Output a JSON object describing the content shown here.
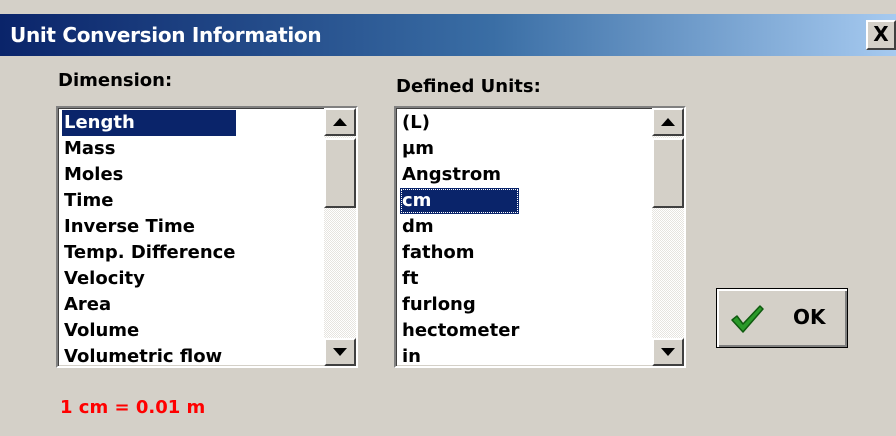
{
  "window": {
    "title": "Unit Conversion Information",
    "close_label": "X"
  },
  "dimension": {
    "label": "Dimension:",
    "selected": "Length",
    "items": [
      "Length",
      "Mass",
      "Moles",
      "Time",
      "Inverse Time",
      "Temp. Difference",
      "Velocity",
      "Area",
      "Volume",
      "Volumetric flow"
    ]
  },
  "units": {
    "label": "Defined Units:",
    "selected": "cm",
    "items": [
      "(L)",
      "µm",
      "Angstrom",
      "cm",
      "dm",
      "fathom",
      "ft",
      "furlong",
      "hectometer",
      "in"
    ]
  },
  "ok_button": {
    "label": "OK",
    "icon": "checkmark-icon"
  },
  "conversion_result": "1 cm = 0.01 m",
  "colors": {
    "selection": "#0a246a",
    "result_text": "#ff0000",
    "check_green": "#2a9a2a",
    "dialog_bg": "#d4d0c8"
  }
}
